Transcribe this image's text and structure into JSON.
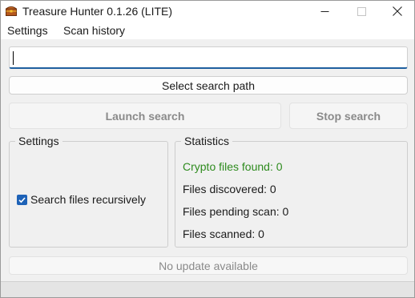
{
  "window": {
    "title": "Treasure Hunter 0.1.26 (LITE)",
    "icon": "treasure-chest-icon",
    "controls": {
      "minimize_icon": "minimize-icon",
      "maximize_icon": "maximize-icon",
      "close_icon": "close-icon"
    }
  },
  "menu": {
    "items": [
      {
        "label": "Settings"
      },
      {
        "label": "Scan history"
      }
    ]
  },
  "search": {
    "value": ""
  },
  "buttons": {
    "select_path": "Select search path",
    "launch": "Launch search",
    "stop": "Stop search"
  },
  "settings_group": {
    "title": "Settings",
    "recursive_checkbox": {
      "label": "Search files recursively",
      "checked": true
    }
  },
  "statistics_group": {
    "title": "Statistics",
    "crypto_found": "Crypto files found: 0",
    "files_discovered": "Files discovered: 0",
    "files_pending": "Files pending scan: 0",
    "files_scanned": "Files scanned: 0"
  },
  "update": {
    "status": "No update available"
  },
  "colors": {
    "accent": "#1e62b7",
    "crypto_text": "#2e8b1e",
    "disabled_text": "#8a8a8a"
  }
}
